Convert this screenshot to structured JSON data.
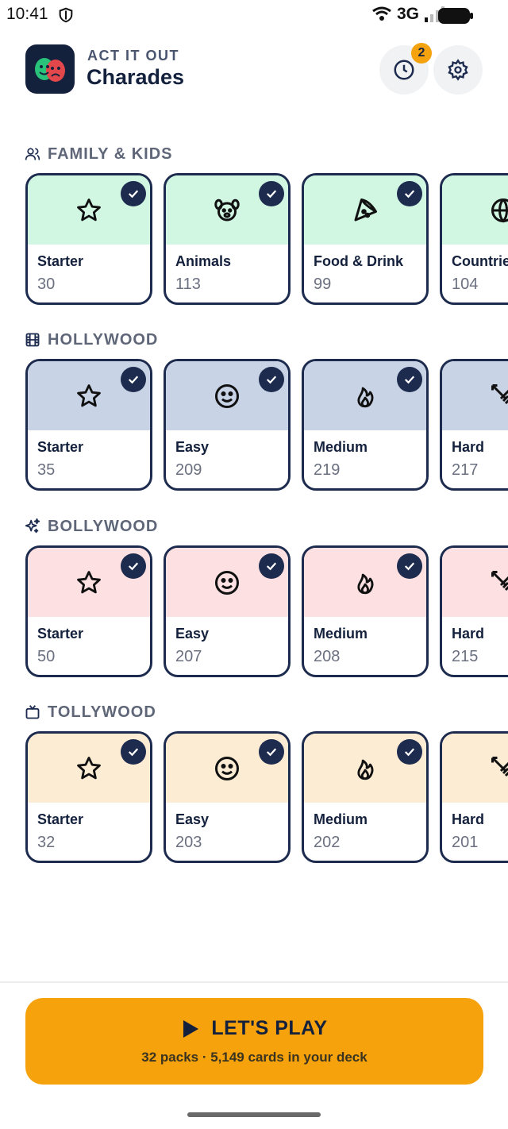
{
  "status_bar": {
    "time": "10:41",
    "network": "3G"
  },
  "header": {
    "subtitle": "ACT IT OUT",
    "title": "Charades",
    "history_badge": "2"
  },
  "sections": [
    {
      "title": "FAMILY & KIDS",
      "icon": "people-icon",
      "color": "#d1f7e3",
      "cards": [
        {
          "name": "Starter",
          "count": "30",
          "icon": "star-icon",
          "checked": true
        },
        {
          "name": "Animals",
          "count": "113",
          "icon": "dog-face-icon",
          "checked": true
        },
        {
          "name": "Food & Drink",
          "count": "99",
          "icon": "pizza-icon",
          "checked": true
        },
        {
          "name": "Countrie",
          "count": "104",
          "icon": "globe-icon",
          "checked": true
        }
      ]
    },
    {
      "title": "HOLLYWOOD",
      "icon": "film-icon",
      "color": "#c9d3e6",
      "cards": [
        {
          "name": "Starter",
          "count": "35",
          "icon": "star-icon",
          "checked": true
        },
        {
          "name": "Easy",
          "count": "209",
          "icon": "smile-icon",
          "checked": true
        },
        {
          "name": "Medium",
          "count": "219",
          "icon": "flame-icon",
          "checked": true
        },
        {
          "name": "Hard",
          "count": "217",
          "icon": "swords-icon",
          "checked": true
        }
      ]
    },
    {
      "title": "BOLLYWOOD",
      "icon": "sparkles-icon",
      "color": "#fde0e1",
      "cards": [
        {
          "name": "Starter",
          "count": "50",
          "icon": "star-icon",
          "checked": true
        },
        {
          "name": "Easy",
          "count": "207",
          "icon": "smile-icon",
          "checked": true
        },
        {
          "name": "Medium",
          "count": "208",
          "icon": "flame-icon",
          "checked": true
        },
        {
          "name": "Hard",
          "count": "215",
          "icon": "swords-icon",
          "checked": true
        }
      ]
    },
    {
      "title": "TOLLYWOOD",
      "icon": "tv-icon",
      "color": "#fdecd4",
      "cards": [
        {
          "name": "Starter",
          "count": "32",
          "icon": "star-icon",
          "checked": true
        },
        {
          "name": "Easy",
          "count": "203",
          "icon": "smile-icon",
          "checked": true
        },
        {
          "name": "Medium",
          "count": "202",
          "icon": "flame-icon",
          "checked": true
        },
        {
          "name": "Hard",
          "count": "201",
          "icon": "swords-icon",
          "checked": true
        }
      ]
    }
  ],
  "play": {
    "label": "LET'S PLAY",
    "summary": "32 packs · 5,149 cards in your deck"
  },
  "colors": {
    "primary": "#1d2b4f",
    "accent": "#f5a20c"
  }
}
